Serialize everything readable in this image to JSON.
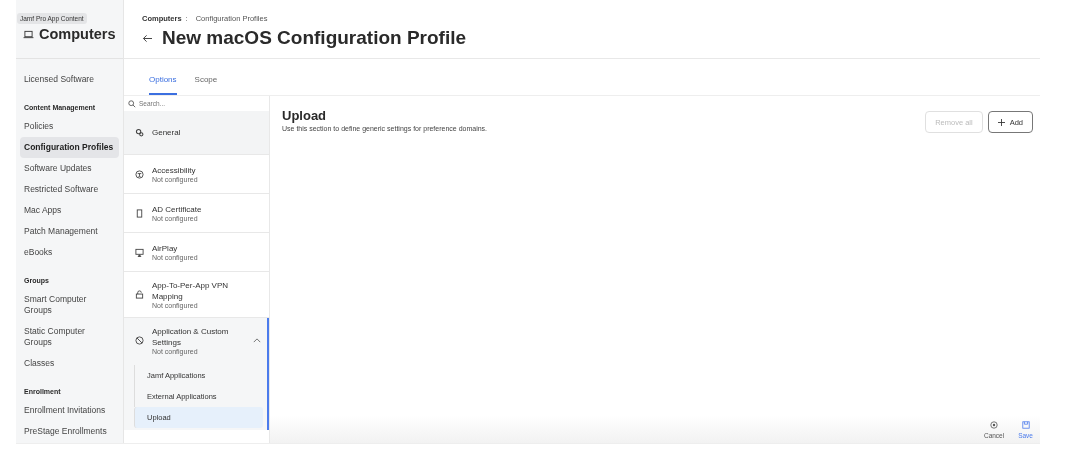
{
  "sidebar": {
    "tooltip": "Jamf Pro App Content",
    "title": "Computers",
    "items": [
      {
        "kind": "item",
        "label": "Licensed Software",
        "selected": false
      },
      {
        "kind": "heading",
        "label": "Content Management"
      },
      {
        "kind": "item",
        "label": "Policies",
        "selected": false
      },
      {
        "kind": "item",
        "label": "Configuration Profiles",
        "selected": true
      },
      {
        "kind": "item",
        "label": "Software Updates",
        "selected": false
      },
      {
        "kind": "item",
        "label": "Restricted Software",
        "selected": false
      },
      {
        "kind": "item",
        "label": "Mac Apps",
        "selected": false
      },
      {
        "kind": "item",
        "label": "Patch Management",
        "selected": false
      },
      {
        "kind": "item",
        "label": "eBooks",
        "selected": false
      },
      {
        "kind": "heading",
        "label": "Groups"
      },
      {
        "kind": "item",
        "label": "Smart Computer Groups",
        "selected": false
      },
      {
        "kind": "item",
        "label": "Static Computer Groups",
        "selected": false
      },
      {
        "kind": "item",
        "label": "Classes",
        "selected": false
      },
      {
        "kind": "heading",
        "label": "Enrollment"
      },
      {
        "kind": "item",
        "label": "Enrollment Invitations",
        "selected": false
      },
      {
        "kind": "item",
        "label": "PreStage Enrollments",
        "selected": false
      }
    ]
  },
  "breadcrumb": {
    "parent": "Computers",
    "separator": ":",
    "current": "Configuration Profiles"
  },
  "page_title": "New macOS Configuration Profile",
  "tabs": [
    {
      "label": "Options",
      "selected": true
    },
    {
      "label": "Scope",
      "selected": false
    }
  ],
  "search": {
    "placeholder": "Search..."
  },
  "payloads": [
    {
      "kind": "general",
      "name": "General"
    },
    {
      "kind": "payload",
      "name": "Accessibility",
      "status": "Not configured"
    },
    {
      "kind": "payload",
      "name": "AD Certificate",
      "status": "Not configured"
    },
    {
      "kind": "payload",
      "name": "AirPlay",
      "status": "Not configured"
    },
    {
      "kind": "payload",
      "name": "App-To-Per-App VPN Mapping",
      "status": "Not configured"
    },
    {
      "kind": "payload",
      "name": "Application & Custom Settings",
      "status": "Not configured",
      "expanded": true,
      "children": [
        {
          "label": "Jamf Applications",
          "selected": false
        },
        {
          "label": "External Applications",
          "selected": false
        },
        {
          "label": "Upload",
          "selected": true
        }
      ]
    }
  ],
  "section": {
    "title": "Upload",
    "description": "Use this section to define generic settings for preference domains.",
    "buttons": [
      {
        "kind": "remove",
        "label": "Remove all",
        "disabled": true
      },
      {
        "kind": "add",
        "label": "Add",
        "disabled": false
      }
    ]
  },
  "footer": [
    {
      "kind": "cancel",
      "label": "Cancel"
    },
    {
      "kind": "save",
      "label": "Save"
    }
  ]
}
